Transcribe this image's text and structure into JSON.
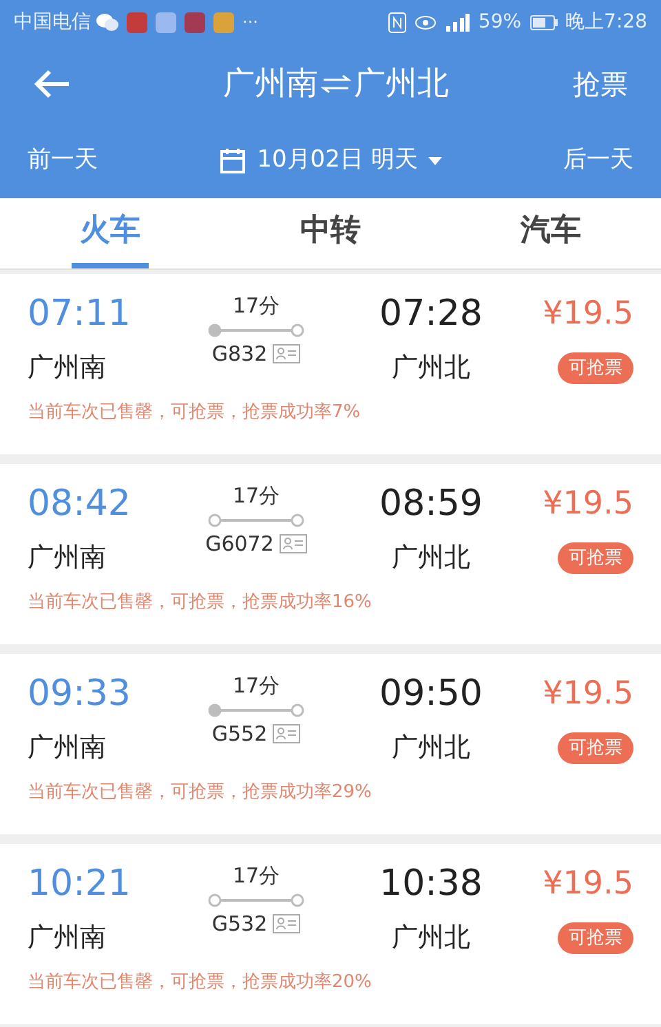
{
  "status_bar": {
    "carrier": "中国电信",
    "more": "···",
    "battery": "59%",
    "time": "晚上7:28"
  },
  "header": {
    "title_from": "广州南",
    "title_to": "广州北",
    "action": "抢票"
  },
  "date_bar": {
    "prev": "前一天",
    "date": "10月02日 明天",
    "next": "后一天"
  },
  "tabs": [
    {
      "label": "火车",
      "selected": true
    },
    {
      "label": "中转",
      "selected": false
    },
    {
      "label": "汽车",
      "selected": false
    }
  ],
  "trains": [
    {
      "depart": "07:11",
      "from": "广州南",
      "duration": "17分",
      "train_no": "G832",
      "origin_station": true,
      "arrive": "07:28",
      "to": "广州北",
      "price": "¥19.5",
      "badge": "可抢票",
      "note": "当前车次已售罄，可抢票，抢票成功率7%"
    },
    {
      "depart": "08:42",
      "from": "广州南",
      "duration": "17分",
      "train_no": "G6072",
      "origin_station": false,
      "arrive": "08:59",
      "to": "广州北",
      "price": "¥19.5",
      "badge": "可抢票",
      "note": "当前车次已售罄，可抢票，抢票成功率16%"
    },
    {
      "depart": "09:33",
      "from": "广州南",
      "duration": "17分",
      "train_no": "G552",
      "origin_station": true,
      "arrive": "09:50",
      "to": "广州北",
      "price": "¥19.5",
      "badge": "可抢票",
      "note": "当前车次已售罄，可抢票，抢票成功率29%"
    },
    {
      "depart": "10:21",
      "from": "广州南",
      "duration": "17分",
      "train_no": "G532",
      "origin_station": false,
      "arrive": "10:38",
      "to": "广州北",
      "price": "¥19.5",
      "badge": "可抢票",
      "note": "当前车次已售罄，可抢票，抢票成功率20%"
    }
  ]
}
